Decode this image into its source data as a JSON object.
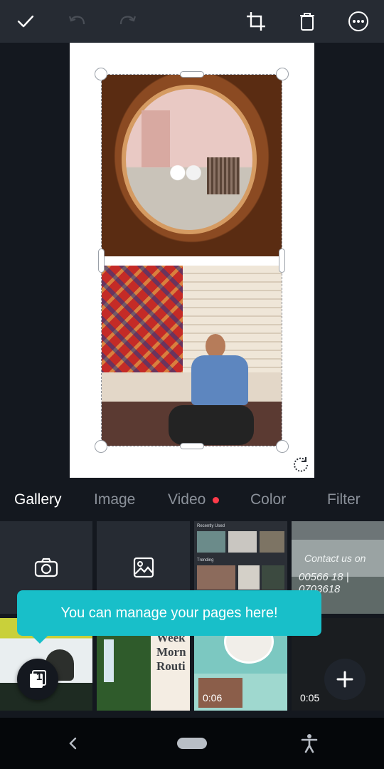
{
  "topbar": {
    "icons": [
      "check-icon",
      "undo-icon",
      "redo-icon",
      "crop-icon",
      "trash-icon",
      "more-icon"
    ]
  },
  "canvas": {
    "page_background": "#ffffff",
    "selection_color": "#8a8f99"
  },
  "tabs": {
    "gallery": "Gallery",
    "image": "Image",
    "video": "Video",
    "color": "Color",
    "filter": "Filter",
    "active": "Gallery"
  },
  "gallery": {
    "camera_label": "camera-icon",
    "gallery_label": "image-icon",
    "thumb_city_text_1": "Contact us on",
    "thumb_city_text_2": "00566 18 | 0703618",
    "thumb_weekend_text": "Week\nMorn\nRouti",
    "durations": {
      "birthday": "0:06",
      "dark": "0:05"
    },
    "canva_thumb": {
      "recently_used": "Recently Used",
      "trending": "Trending"
    }
  },
  "tooltip": {
    "text": "You can manage your pages here!"
  },
  "pages_button": {
    "count": "1"
  },
  "colors": {
    "accent_teal": "#18bfc9",
    "video_dot": "#ff3b4a",
    "topbar": "#262b33",
    "background": "#14181f"
  }
}
